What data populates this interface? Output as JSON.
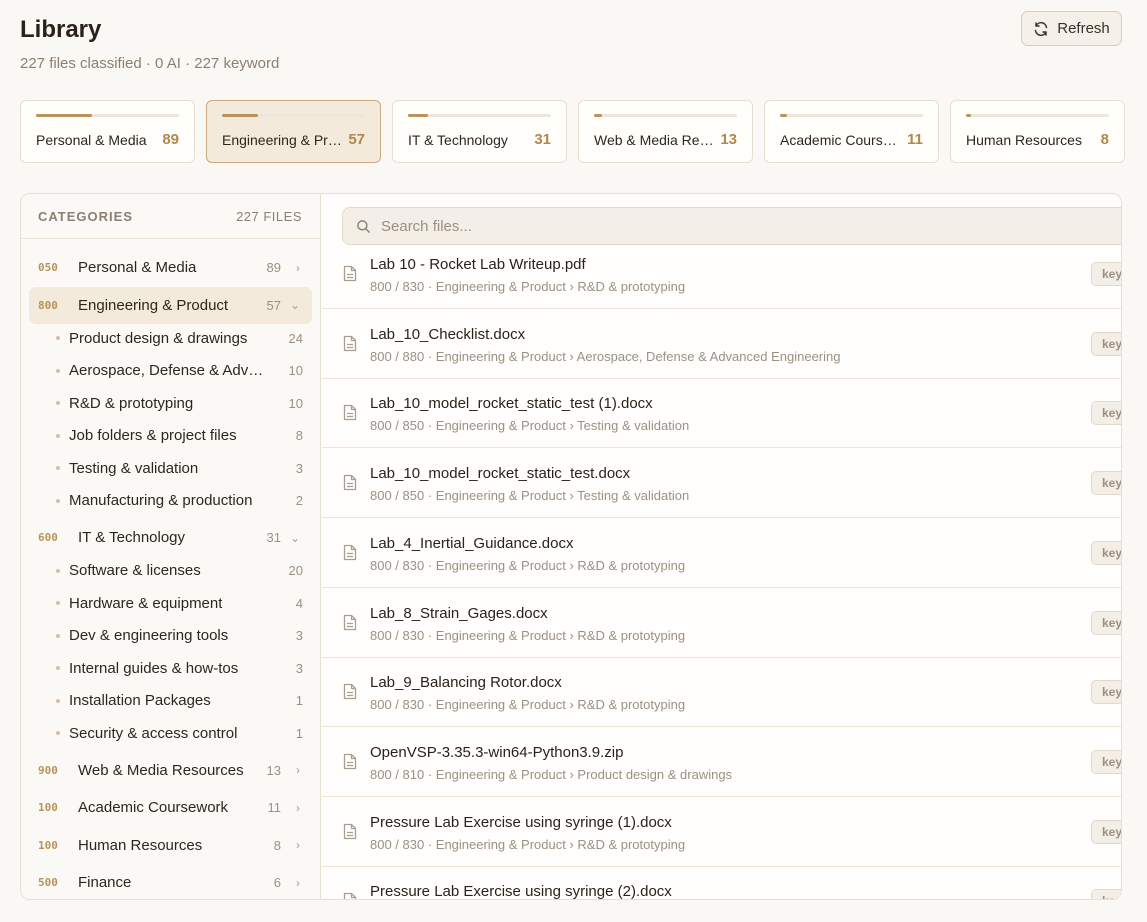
{
  "header": {
    "title": "Library",
    "subtitle": "227 files classified · 0 AI · 227 keyword",
    "refresh_label": "Refresh"
  },
  "cards": [
    {
      "label": "Personal & Media",
      "count": "89",
      "share": 0.392,
      "active": false
    },
    {
      "label": "Engineering & Product",
      "count": "57",
      "share": 0.251,
      "active": true
    },
    {
      "label": "IT & Technology",
      "count": "31",
      "share": 0.137,
      "active": false
    },
    {
      "label": "Web & Media Resources",
      "count": "13",
      "share": 0.057,
      "active": false
    },
    {
      "label": "Academic Coursework",
      "count": "11",
      "share": 0.048,
      "active": false
    },
    {
      "label": "Human Resources",
      "count": "8",
      "share": 0.035,
      "active": false
    }
  ],
  "sidebar": {
    "heading": "CATEGORIES",
    "total_files": "227 FILES",
    "items": [
      {
        "kind": "cat",
        "code": "050",
        "name": "Personal & Media",
        "count": "89",
        "chevron": "›",
        "active": false
      },
      {
        "kind": "cat",
        "code": "800",
        "name": "Engineering & Product",
        "count": "57",
        "chevron": "⌄",
        "active": true
      },
      {
        "kind": "sub",
        "name": "Product design & drawings",
        "count": "24"
      },
      {
        "kind": "sub",
        "name": "Aerospace, Defense & Advanced Engineering",
        "count": "10"
      },
      {
        "kind": "sub",
        "name": "R&D & prototyping",
        "count": "10"
      },
      {
        "kind": "sub",
        "name": "Job folders & project files",
        "count": "8"
      },
      {
        "kind": "sub",
        "name": "Testing & validation",
        "count": "3"
      },
      {
        "kind": "sub",
        "name": "Manufacturing & production",
        "count": "2"
      },
      {
        "kind": "cat",
        "code": "600",
        "name": "IT & Technology",
        "count": "31",
        "chevron": "⌄",
        "active": false
      },
      {
        "kind": "sub",
        "name": "Software & licenses",
        "count": "20"
      },
      {
        "kind": "sub",
        "name": "Hardware & equipment",
        "count": "4"
      },
      {
        "kind": "sub",
        "name": "Dev & engineering tools",
        "count": "3"
      },
      {
        "kind": "sub",
        "name": "Internal guides & how-tos",
        "count": "3"
      },
      {
        "kind": "sub",
        "name": "Installation Packages",
        "count": "1"
      },
      {
        "kind": "sub",
        "name": "Security & access control",
        "count": "1"
      },
      {
        "kind": "cat",
        "code": "900",
        "name": "Web & Media Resources",
        "count": "13",
        "chevron": "›",
        "active": false
      },
      {
        "kind": "cat",
        "code": "100",
        "name": "Academic Coursework",
        "count": "11",
        "chevron": "›",
        "active": false
      },
      {
        "kind": "cat",
        "code": "100",
        "name": "Human Resources",
        "count": "8",
        "chevron": "›",
        "active": false
      },
      {
        "kind": "cat",
        "code": "500",
        "name": "Finance",
        "count": "6",
        "chevron": "›",
        "active": false
      }
    ]
  },
  "search": {
    "placeholder": "Search files...",
    "value": ""
  },
  "files": [
    {
      "name": "Lab 10 - Rocket Lab Writeup.pdf",
      "path": "800 / 830 · Engineering & Product › R&D & prototyping",
      "tag": "key"
    },
    {
      "name": "Lab_10_Checklist.docx",
      "path": "800 / 880 · Engineering & Product › Aerospace, Defense & Advanced Engineering",
      "tag": "key"
    },
    {
      "name": "Lab_10_model_rocket_static_test (1).docx",
      "path": "800 / 850 · Engineering & Product › Testing & validation",
      "tag": "key"
    },
    {
      "name": "Lab_10_model_rocket_static_test.docx",
      "path": "800 / 850 · Engineering & Product › Testing & validation",
      "tag": "key"
    },
    {
      "name": "Lab_4_Inertial_Guidance.docx",
      "path": "800 / 830 · Engineering & Product › R&D & prototyping",
      "tag": "key"
    },
    {
      "name": "Lab_8_Strain_Gages.docx",
      "path": "800 / 830 · Engineering & Product › R&D & prototyping",
      "tag": "key"
    },
    {
      "name": "Lab_9_Balancing Rotor.docx",
      "path": "800 / 830 · Engineering & Product › R&D & prototyping",
      "tag": "key"
    },
    {
      "name": "OpenVSP-3.35.3-win64-Python3.9.zip",
      "path": "800 / 810 · Engineering & Product › Product design & drawings",
      "tag": "key"
    },
    {
      "name": "Pressure Lab Exercise using syringe (1).docx",
      "path": "800 / 830 · Engineering & Product › R&D & prototyping",
      "tag": "key"
    },
    {
      "name": "Pressure Lab Exercise using syringe (2).docx",
      "path": "",
      "tag": "key"
    }
  ],
  "colors": {
    "accent": "#b8935a",
    "background": "#faf8f4",
    "active_bg": "#f3eadb",
    "border": "#e6ded0"
  }
}
